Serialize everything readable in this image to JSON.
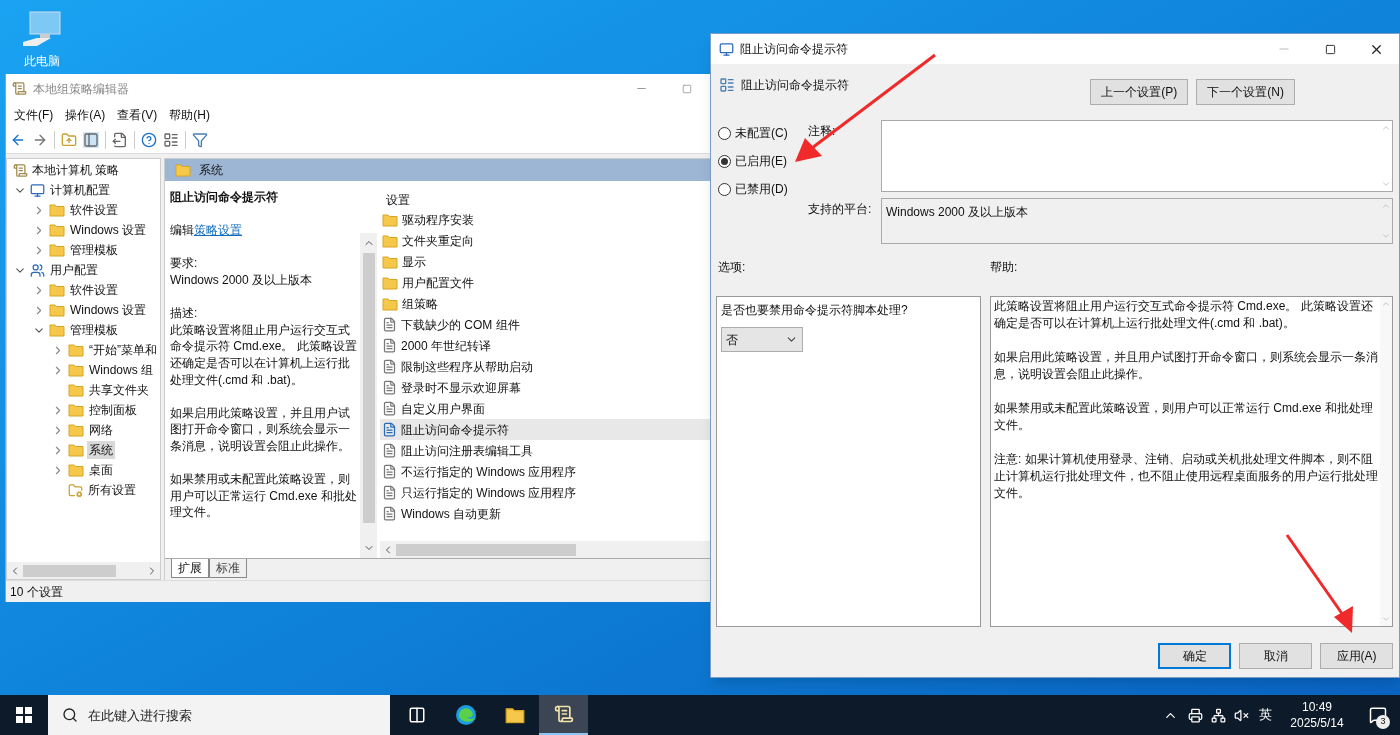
{
  "desktop": {
    "icons": [
      {
        "label": "此电脑"
      }
    ]
  },
  "editor": {
    "title": "本地组策略编辑器",
    "menu": [
      "文件(F)",
      "操作(A)",
      "查看(V)",
      "帮助(H)"
    ],
    "tree": {
      "label": "本地计算机 策略",
      "children": [
        {
          "label": "计算机配置",
          "kind": "computer",
          "expandable": true,
          "expanded": true,
          "selected": false,
          "children": [
            {
              "label": "软件设置",
              "kind": "folder",
              "expandable": true,
              "expanded": false,
              "selected": false
            },
            {
              "label": "Windows 设置",
              "kind": "folder",
              "expandable": true,
              "expanded": false,
              "selected": false
            },
            {
              "label": "管理模板",
              "kind": "folder",
              "expandable": true,
              "expanded": false,
              "selected": false
            }
          ]
        },
        {
          "label": "用户配置",
          "kind": "users",
          "expandable": true,
          "expanded": true,
          "selected": false,
          "children": [
            {
              "label": "软件设置",
              "kind": "folder",
              "expandable": true,
              "expanded": false,
              "selected": false
            },
            {
              "label": "Windows 设置",
              "kind": "folder",
              "expandable": true,
              "expanded": false,
              "selected": false
            },
            {
              "label": "管理模板",
              "kind": "folder",
              "expandable": true,
              "expanded": true,
              "selected": false,
              "children": [
                {
                  "label": "“开始”菜单和",
                  "kind": "folder",
                  "expandable": true,
                  "expanded": false,
                  "selected": false
                },
                {
                  "label": "Windows 组",
                  "kind": "folder",
                  "expandable": true,
                  "expanded": false,
                  "selected": false
                },
                {
                  "label": "共享文件夹",
                  "kind": "folder",
                  "expandable": false,
                  "selected": false
                },
                {
                  "label": "控制面板",
                  "kind": "folder",
                  "expandable": true,
                  "expanded": false,
                  "selected": false
                },
                {
                  "label": "网络",
                  "kind": "folder",
                  "expandable": true,
                  "expanded": false,
                  "selected": false
                },
                {
                  "label": "系统",
                  "kind": "folder",
                  "expandable": true,
                  "expanded": false,
                  "selected": true
                },
                {
                  "label": "桌面",
                  "kind": "folder",
                  "expandable": true,
                  "expanded": false,
                  "selected": false
                },
                {
                  "label": "所有设置",
                  "kind": "settings",
                  "expandable": false,
                  "selected": false
                }
              ]
            }
          ]
        }
      ]
    },
    "header": "系统",
    "description": {
      "title": "阻止访问命令提示符",
      "edit_prefix": "编辑",
      "edit_link": "策略设置",
      "requirements_label": "要求:",
      "requirements": "Windows 2000 及以上版本",
      "description_label": "描述:",
      "paragraphs": [
        "此策略设置将阻止用户运行交互式命令提示符 Cmd.exe。 此策略设置还确定是否可以在计算机上运行批处理文件(.cmd 和 .bat)。",
        "如果启用此策略设置，并且用户试图打开命令窗口，则系统会显示一条消息，说明设置会阻止此操作。",
        "如果禁用或未配置此策略设置，则用户可以正常运行 Cmd.exe 和批处理文件。"
      ]
    },
    "list": {
      "column": "设置",
      "items": [
        {
          "label": "驱动程序安装",
          "kind": "folder",
          "selected": false
        },
        {
          "label": "文件夹重定向",
          "kind": "folder",
          "selected": false
        },
        {
          "label": "显示",
          "kind": "folder",
          "selected": false
        },
        {
          "label": "用户配置文件",
          "kind": "folder",
          "selected": false
        },
        {
          "label": "组策略",
          "kind": "folder",
          "selected": false
        },
        {
          "label": "下载缺少的 COM 组件",
          "kind": "policy",
          "selected": false
        },
        {
          "label": "2000 年世纪转译",
          "kind": "policy",
          "selected": false
        },
        {
          "label": "限制这些程序从帮助启动",
          "kind": "policy",
          "selected": false
        },
        {
          "label": "登录时不显示欢迎屏幕",
          "kind": "policy",
          "selected": false
        },
        {
          "label": "自定义用户界面",
          "kind": "policy",
          "selected": false
        },
        {
          "label": "阻止访问命令提示符",
          "kind": "policy",
          "selected": true
        },
        {
          "label": "阻止访问注册表编辑工具",
          "kind": "policy",
          "selected": false
        },
        {
          "label": "不运行指定的 Windows 应用程序",
          "kind": "policy",
          "selected": false
        },
        {
          "label": "只运行指定的 Windows 应用程序",
          "kind": "policy",
          "selected": false
        },
        {
          "label": "Windows 自动更新",
          "kind": "policy",
          "selected": false
        }
      ]
    },
    "tabs": [
      {
        "label": "扩展",
        "selected": true
      },
      {
        "label": "标准",
        "selected": false
      }
    ],
    "status_bar": "10 个设置"
  },
  "dialog": {
    "title": "阻止访问命令提示符",
    "setting_name": "阻止访问命令提示符",
    "nav_buttons": [
      "上一个设置(P)",
      "下一个设置(N)"
    ],
    "states": [
      {
        "label": "未配置(C)",
        "selected": false
      },
      {
        "label": "已启用(E)",
        "selected": true
      },
      {
        "label": "已禁用(D)",
        "selected": false
      }
    ],
    "comment_label": "注释:",
    "platform_label": "支持的平台:",
    "platform": "Windows 2000 及以上版本",
    "options_label": "选项:",
    "help_label": "帮助:",
    "option": {
      "label": "是否也要禁用命令提示符脚本处理?",
      "value": "否"
    },
    "help": [
      "此策略设置将阻止用户运行交互式命令提示符 Cmd.exe。 此策略设置还确定是否可以在计算机上运行批处理文件(.cmd 和 .bat)。",
      "如果启用此策略设置，并且用户试图打开命令窗口，则系统会显示一条消息，说明设置会阻止此操作。",
      "如果禁用或未配置此策略设置，则用户可以正常运行 Cmd.exe 和批处理文件。",
      "注意: 如果计算机使用登录、注销、启动或关机批处理文件脚本，则不阻止计算机运行批处理文件，也不阻止使用远程桌面服务的用户运行批处理文件。"
    ],
    "buttons": [
      {
        "label": "确定",
        "default": true
      },
      {
        "label": "取消",
        "default": false
      },
      {
        "label": "应用(A)",
        "default": false
      }
    ]
  },
  "taskbar": {
    "search_placeholder": "在此键入进行搜索",
    "apps": [
      {
        "kind": "task-view",
        "active": false
      },
      {
        "kind": "browser",
        "active": false
      },
      {
        "kind": "explorer",
        "active": false
      },
      {
        "kind": "policy-editor",
        "active": true
      }
    ],
    "input_indicator": "英",
    "time": "10:49",
    "date": "2025/5/14",
    "notification_count": "3"
  }
}
